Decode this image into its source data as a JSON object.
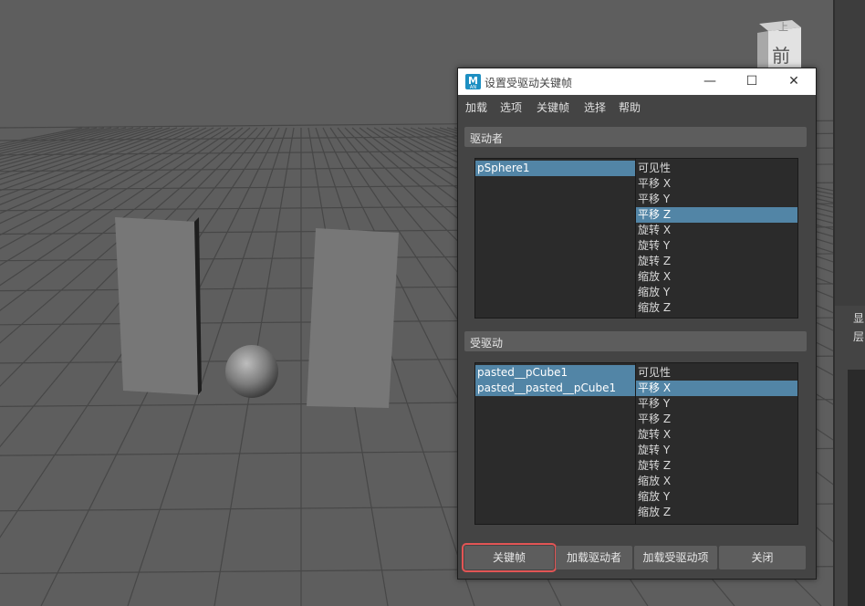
{
  "viewport": {
    "view_cube": {
      "top_label": "上",
      "front_label": "前"
    }
  },
  "right_panel": {
    "label_1": "显",
    "label_2": "层"
  },
  "dialog": {
    "title": "设置受驱动关键帧",
    "app_icon_letter": "M",
    "app_icon_sub": "AN",
    "window_controls": {
      "minimize": "—",
      "maximize": "☐",
      "close": "✕"
    },
    "menu": [
      "加载",
      "选项",
      "关键帧",
      "选择",
      "帮助"
    ],
    "driver": {
      "header": "驱动者",
      "objects": [
        {
          "label": "pSphere1",
          "selected": true
        }
      ],
      "attributes": [
        {
          "label": "可见性",
          "selected": false
        },
        {
          "label": "平移 X",
          "selected": false
        },
        {
          "label": "平移 Y",
          "selected": false
        },
        {
          "label": "平移 Z",
          "selected": true
        },
        {
          "label": "旋转 X",
          "selected": false
        },
        {
          "label": "旋转 Y",
          "selected": false
        },
        {
          "label": "旋转 Z",
          "selected": false
        },
        {
          "label": "缩放 X",
          "selected": false
        },
        {
          "label": "缩放 Y",
          "selected": false
        },
        {
          "label": "缩放 Z",
          "selected": false
        }
      ]
    },
    "driven": {
      "header": "受驱动",
      "objects": [
        {
          "label": "pasted__pCube1",
          "selected": true
        },
        {
          "label": "pasted__pasted__pCube1",
          "selected": true
        }
      ],
      "attributes": [
        {
          "label": "可见性",
          "selected": false
        },
        {
          "label": "平移 X",
          "selected": true
        },
        {
          "label": "平移 Y",
          "selected": false
        },
        {
          "label": "平移 Z",
          "selected": false
        },
        {
          "label": "旋转 X",
          "selected": false
        },
        {
          "label": "旋转 Y",
          "selected": false
        },
        {
          "label": "旋转 Z",
          "selected": false
        },
        {
          "label": "缩放 X",
          "selected": false
        },
        {
          "label": "缩放 Y",
          "selected": false
        },
        {
          "label": "缩放 Z",
          "selected": false
        }
      ]
    },
    "buttons": {
      "key": "关键帧",
      "load_driver": "加载驱动者",
      "load_driven": "加载受驱动项",
      "close": "关闭"
    }
  },
  "colors": {
    "viewport_bg": "#5e5e5e",
    "grid_line": "#474747",
    "selection": "#5285a6",
    "highlight_outline": "#e25555"
  }
}
